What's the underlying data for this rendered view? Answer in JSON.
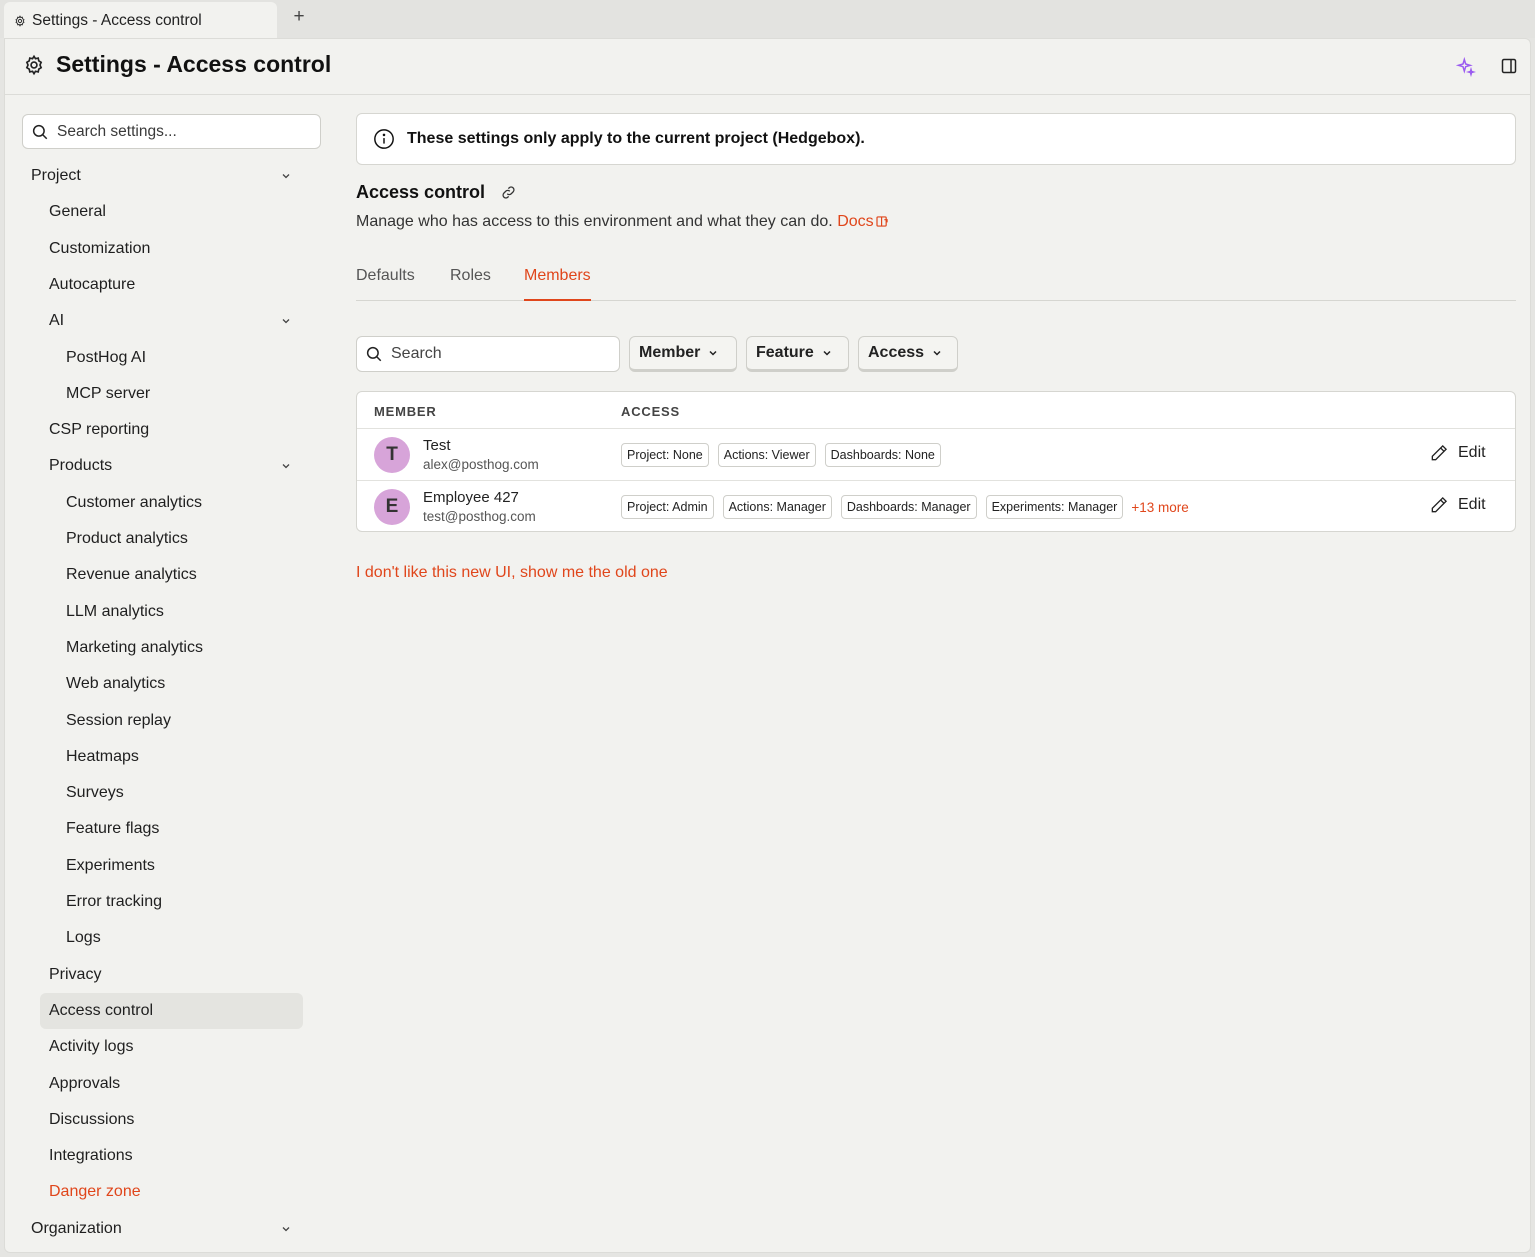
{
  "tab": {
    "label": "Settings - Access control",
    "new_tab_symbol": "+"
  },
  "header": {
    "title": "Settings - Access control"
  },
  "sidebar": {
    "search_placeholder": "Search settings...",
    "items": [
      {
        "label": "Project",
        "level": 0,
        "expandable": true
      },
      {
        "label": "General",
        "level": 1
      },
      {
        "label": "Customization",
        "level": 1
      },
      {
        "label": "Autocapture",
        "level": 1
      },
      {
        "label": "AI",
        "level": 1,
        "expandable": true
      },
      {
        "label": "PostHog AI",
        "level": 2
      },
      {
        "label": "MCP server",
        "level": 2
      },
      {
        "label": "CSP reporting",
        "level": 1
      },
      {
        "label": "Products",
        "level": 1,
        "expandable": true
      },
      {
        "label": "Customer analytics",
        "level": 2
      },
      {
        "label": "Product analytics",
        "level": 2
      },
      {
        "label": "Revenue analytics",
        "level": 2
      },
      {
        "label": "LLM analytics",
        "level": 2
      },
      {
        "label": "Marketing analytics",
        "level": 2
      },
      {
        "label": "Web analytics",
        "level": 2
      },
      {
        "label": "Session replay",
        "level": 2
      },
      {
        "label": "Heatmaps",
        "level": 2
      },
      {
        "label": "Surveys",
        "level": 2
      },
      {
        "label": "Feature flags",
        "level": 2
      },
      {
        "label": "Experiments",
        "level": 2
      },
      {
        "label": "Error tracking",
        "level": 2
      },
      {
        "label": "Logs",
        "level": 2
      },
      {
        "label": "Privacy",
        "level": 1
      },
      {
        "label": "Access control",
        "level": 1,
        "active": true
      },
      {
        "label": "Activity logs",
        "level": 1
      },
      {
        "label": "Approvals",
        "level": 1
      },
      {
        "label": "Discussions",
        "level": 1
      },
      {
        "label": "Integrations",
        "level": 1
      },
      {
        "label": "Danger zone",
        "level": 1,
        "danger": true
      },
      {
        "label": "Organization",
        "level": 0,
        "expandable": true
      }
    ]
  },
  "banner": {
    "text": "These settings only apply to the current project (Hedgebox)."
  },
  "section": {
    "title": "Access control",
    "description": "Manage who has access to this environment and what they can do.",
    "docs_label": "Docs"
  },
  "tabs": [
    {
      "label": "Defaults"
    },
    {
      "label": "Roles"
    },
    {
      "label": "Members",
      "active": true
    }
  ],
  "filters": {
    "search_placeholder": "Search",
    "member_label": "Member",
    "feature_label": "Feature",
    "access_label": "Access"
  },
  "table": {
    "col_member": "MEMBER",
    "col_access": "ACCESS",
    "edit_label": "Edit",
    "rows": [
      {
        "initial": "T",
        "name": "Test",
        "email": "alex@posthog.com",
        "badges": [
          "Project: None",
          "Actions: Viewer",
          "Dashboards: None"
        ],
        "more": ""
      },
      {
        "initial": "E",
        "name": "Employee 427",
        "email": "test@posthog.com",
        "badges": [
          "Project: Admin",
          "Actions: Manager",
          "Dashboards: Manager",
          "Experiments: Manager"
        ],
        "more": "+13 more"
      }
    ]
  },
  "old_ui_link": "I don't like this new UI, show me the old one",
  "colors": {
    "accent": "#e0461b",
    "avatar": "#d7a4d9",
    "sparkle": "#9b5cf0"
  }
}
